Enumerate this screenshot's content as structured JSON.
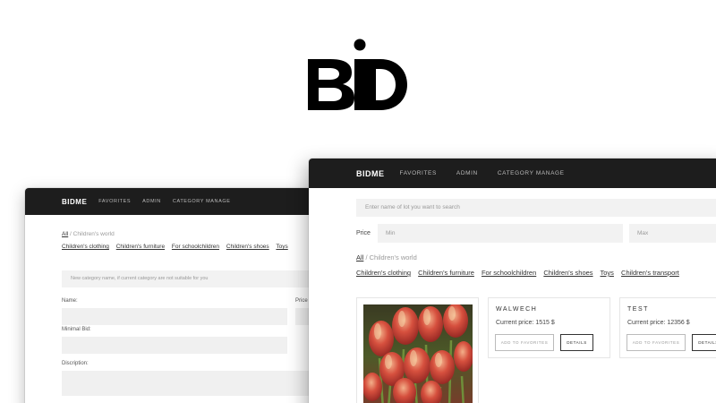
{
  "logo": {
    "text": "BID"
  },
  "back_window": {
    "nav": {
      "brand": "BIDME",
      "links": [
        "FAVORITES",
        "ADMIN",
        "CATEGORY MANAGE"
      ]
    },
    "breadcrumb": {
      "all": "All",
      "separator": "/",
      "current": "Children's world"
    },
    "categories": [
      "Children's clothing",
      "Children's furniture",
      "For schoolchildren",
      "Children's shoes",
      "Toys"
    ],
    "new_category_placeholder": "New category name, if current category are not suitable for you",
    "form": {
      "name_label": "Name:",
      "price_label": "Price",
      "minimal_bid_label": "Minimal Bid:",
      "description_label": "Discription:"
    }
  },
  "front_window": {
    "nav": {
      "brand": "BIDME",
      "links": [
        "FAVORITES",
        "ADMIN",
        "CATEGORY MANAGE"
      ]
    },
    "search_placeholder": "Enter name of lot you want to search",
    "price_filter": {
      "label": "Price",
      "min_placeholder": "Min",
      "max_placeholder": "Max"
    },
    "breadcrumb": {
      "all": "All",
      "separator": "/",
      "current": "Children's world"
    },
    "categories": [
      "Children's clothing",
      "Children's furniture",
      "For schoolchildren",
      "Children's shoes",
      "Toys",
      "Children's transport"
    ],
    "lots": [
      {
        "title": "WALWECH",
        "price": "Current price: 1515 $",
        "favorites_label": "ADD TO FAVORITES",
        "details_label": "DETAILS"
      },
      {
        "title": "TEST",
        "price": "Current price: 12356 $",
        "favorites_label": "ADD TO FAVORITES",
        "details_label": "DETAILS"
      }
    ]
  },
  "colors": {
    "nav_bg": "#1d1d1d",
    "field_bg": "#f2f2f2",
    "accent": "#000000"
  }
}
